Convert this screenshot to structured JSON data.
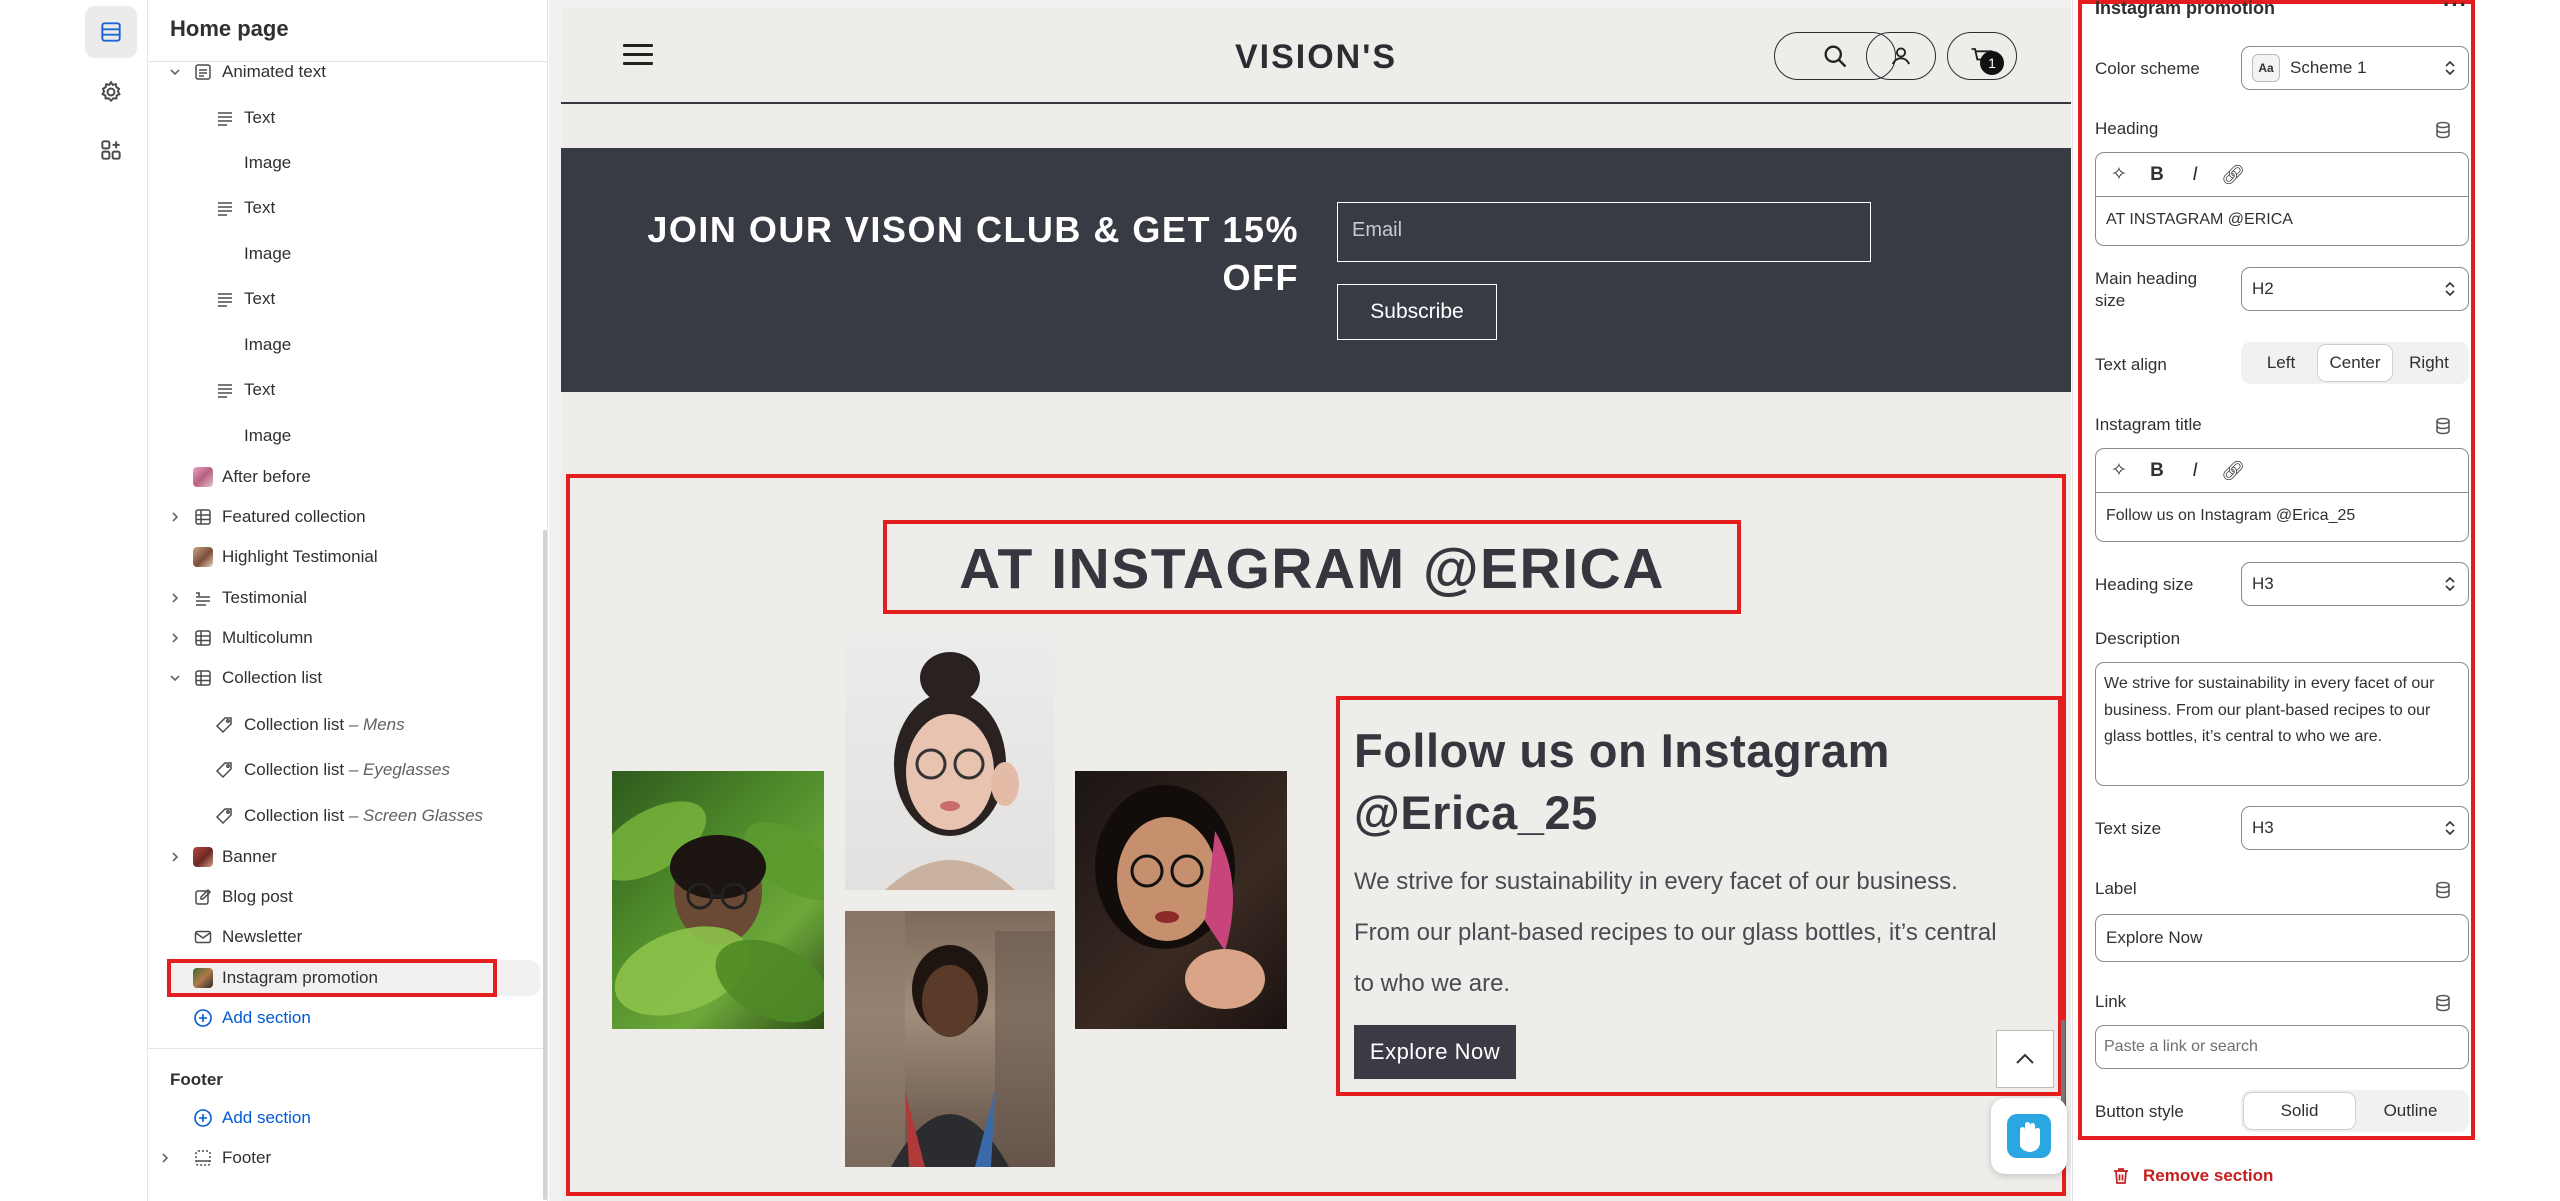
{
  "rail": {
    "items": [
      "sections",
      "settings",
      "apps"
    ]
  },
  "tree": {
    "title": "Home page",
    "items": [
      {
        "label": "Animated text",
        "sub": ""
      },
      {
        "label": "Text",
        "sub": ""
      },
      {
        "label": "Image",
        "sub": ""
      },
      {
        "label": "Text",
        "sub": ""
      },
      {
        "label": "Image",
        "sub": ""
      },
      {
        "label": "Text",
        "sub": ""
      },
      {
        "label": "Image",
        "sub": ""
      },
      {
        "label": "Text",
        "sub": ""
      },
      {
        "label": "Image",
        "sub": ""
      },
      {
        "label": "After before",
        "sub": ""
      },
      {
        "label": "Featured collection",
        "sub": ""
      },
      {
        "label": "Highlight Testimonial",
        "sub": ""
      },
      {
        "label": "Testimonial",
        "sub": ""
      },
      {
        "label": "Multicolumn",
        "sub": ""
      },
      {
        "label": "Collection list",
        "sub": ""
      },
      {
        "label": "Collection list",
        "sub": "Mens"
      },
      {
        "label": "Collection list",
        "sub": "Eyeglasses"
      },
      {
        "label": "Collection list",
        "sub": "Screen Glasses"
      },
      {
        "label": "Banner",
        "sub": ""
      },
      {
        "label": "Blog post",
        "sub": ""
      },
      {
        "label": "Newsletter",
        "sub": ""
      },
      {
        "label": "Instagram promotion",
        "sub": ""
      }
    ],
    "add_section": "Add section",
    "footer_heading": "Footer",
    "footer_add_section": "Add section",
    "footer_item": "Footer"
  },
  "store": {
    "logo": "VISION'S",
    "cart_count": "1",
    "promo_title": "JOIN OUR VISON CLUB & GET 15% OFF",
    "email_placeholder": "Email",
    "subscribe_label": "Subscribe",
    "insta_heading": "AT INSTAGRAM @ERICA",
    "follow_title": "Follow us on Instagram @Erica_25",
    "follow_desc": "We strive for sustainability in every facet of our business. From our plant-based recipes to our glass bottles, it’s central to who we are.",
    "explore_label": "Explore Now"
  },
  "settings": {
    "title": "Instagram promotion",
    "more": "···",
    "color_scheme_label": "Color scheme",
    "color_scheme_chip": "Aa",
    "color_scheme_value": "Scheme 1",
    "heading_label": "Heading",
    "heading_value": "AT INSTAGRAM @ERICA",
    "main_heading_size_label": "Main heading size",
    "main_heading_size_value": "H2",
    "text_align_label": "Text align",
    "text_align_options": [
      "Left",
      "Center",
      "Right"
    ],
    "text_align_selected": "Center",
    "instagram_title_label": "Instagram title",
    "instagram_title_value": "Follow us on Instagram @Erica_25",
    "heading_size_label": "Heading size",
    "heading_size_value": "H3",
    "description_label": "Description",
    "description_value": "We strive for sustainability in every facet of our business. From our plant-based recipes to our glass bottles, it’s central to who we are.",
    "text_size_label": "Text size",
    "text_size_value": "H3",
    "label_label": "Label",
    "label_value": "Explore Now",
    "link_label": "Link",
    "link_placeholder": "Paste a link or search",
    "button_style_label": "Button style",
    "button_style_options": [
      "Solid",
      "Outline"
    ],
    "button_style_selected": "Solid",
    "remove_label": "Remove section"
  },
  "colors": {
    "highlight": "#e41e1e",
    "promo_bg": "#383a44",
    "store_bg": "#efedea",
    "link_blue": "#005bd3",
    "danger": "#c41e1e"
  }
}
